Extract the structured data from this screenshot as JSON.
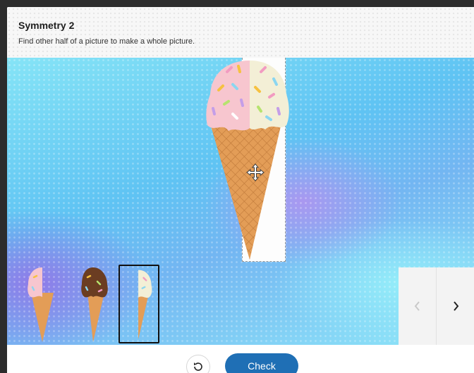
{
  "activity": {
    "title": "Symmetry 2",
    "instruction": "Find other half of a picture to make a whole picture."
  },
  "stage": {
    "target_half": "left-half-pink-scoop",
    "drop_zone": "right-half-empty",
    "cursor_icon": "move-icon"
  },
  "choices": [
    {
      "name": "pink-scoop-half",
      "selected": false
    },
    {
      "name": "chocolate-scoop-half",
      "selected": false
    },
    {
      "name": "vanilla-scoop-half",
      "selected": true
    }
  ],
  "nav": {
    "prev_icon": "chevron-left-icon",
    "next_icon": "chevron-right-icon",
    "prev_enabled": false
  },
  "footer": {
    "reset_icon": "undo-icon",
    "check_label": "Check"
  },
  "colors": {
    "pink_scoop": "#f7c6cf",
    "vanilla_scoop": "#f3efd6",
    "chocolate_scoop": "#6b3d22",
    "cone": "#e09b55",
    "check_button": "#1f6fb5"
  }
}
